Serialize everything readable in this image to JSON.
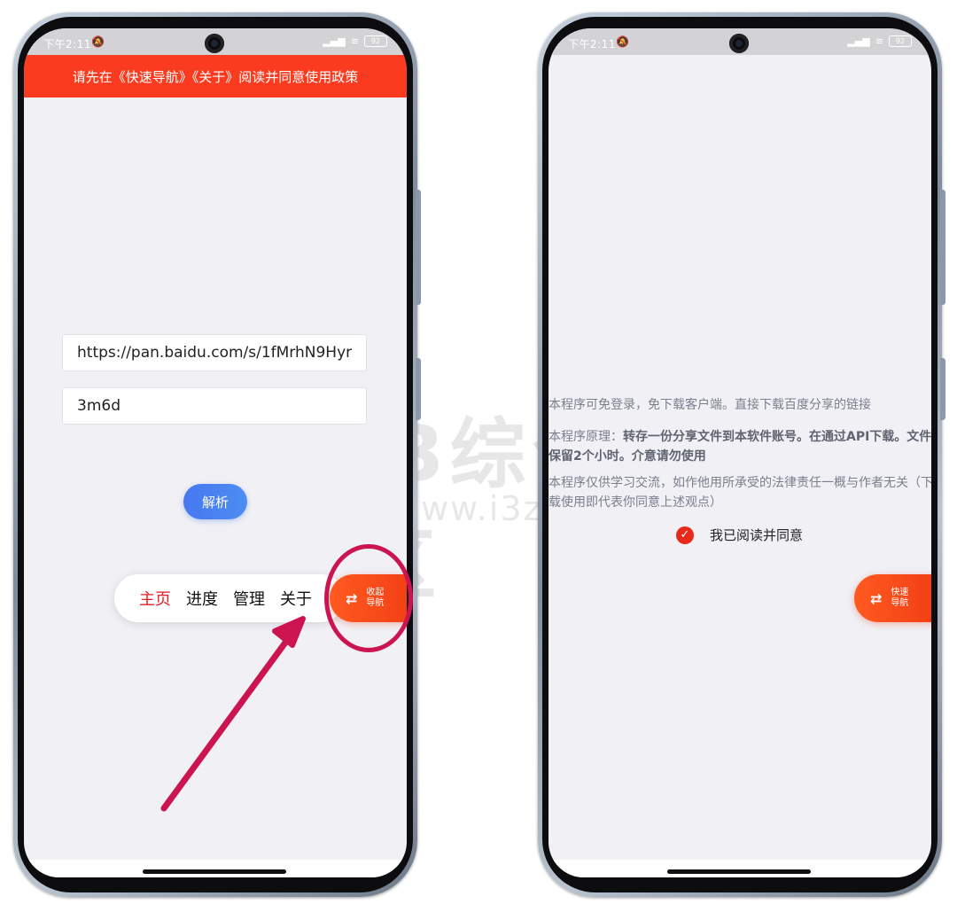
{
  "left_phone": {
    "status": {
      "time": "下午2:11",
      "signal": "HD",
      "battery": "92"
    },
    "banner": "请先在《快速导航》《关于》阅读并同意使用政策",
    "link_input": {
      "value": "https://pan.baidu.com/s/1fMrhN9Hyr"
    },
    "code_input": {
      "value": "3m6d"
    },
    "parse_button": "解析",
    "nav": {
      "home": "主页",
      "progress": "进度",
      "manage": "管理",
      "about": "关于"
    },
    "fab": {
      "line1": "收起",
      "line2": "导航"
    }
  },
  "right_phone": {
    "status": {
      "time": "下午2:11",
      "signal": "HD",
      "battery": "92"
    },
    "policy": {
      "line1": "本程序可免登录，免下载客户端。直接下载百度分享的链接",
      "line2_prefix": "本程序原理：",
      "line2_bold": "转存一份分享文件到本软件账号。在通过API下载。文件保留2个小时。介意请勿使用",
      "line3": "本程序仅供学习交流，如作他用所承受的法律责任一概与作者无关（下载使用即代表你同意上述观点）"
    },
    "agree_label": "我已阅读并同意",
    "fab": {
      "line1": "快速",
      "line2": "导航"
    }
  },
  "watermark": {
    "title": "i3综合社区",
    "url": "www.i3zh.com"
  },
  "colors": {
    "banner": "#fa3b1f",
    "accent_red": "#e51c23",
    "button_blue": "#4777f0",
    "annotation": "#cc1550"
  }
}
